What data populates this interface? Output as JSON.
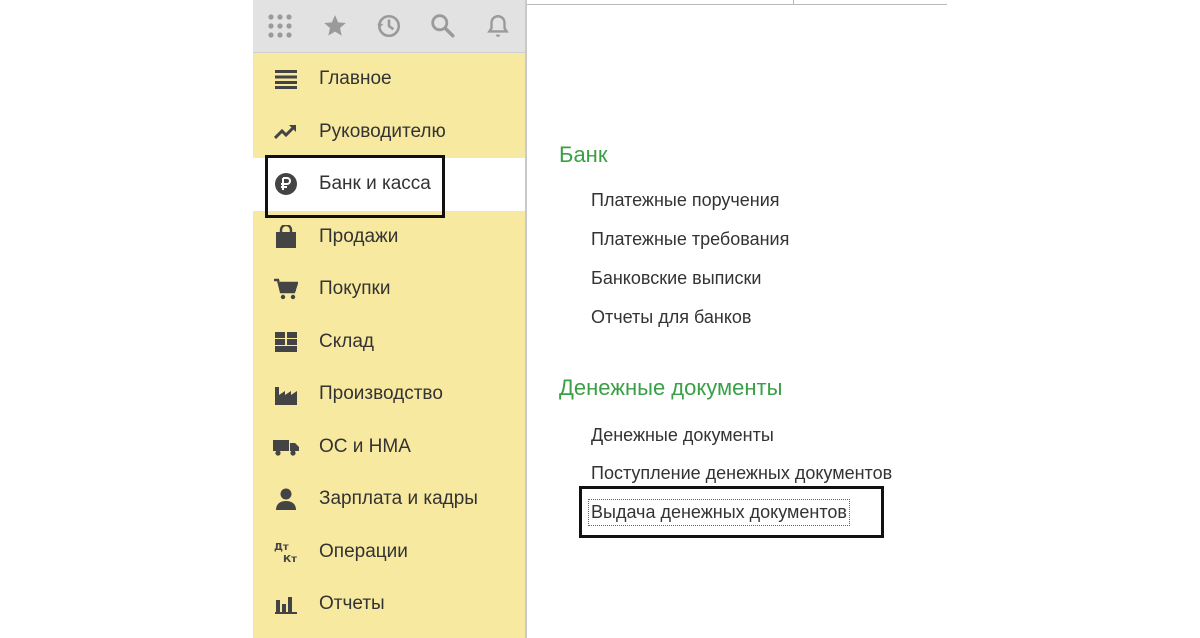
{
  "toolbar": {
    "icons": [
      "apps-grid-icon",
      "favorites-star-icon",
      "history-icon",
      "search-icon",
      "notifications-bell-icon"
    ]
  },
  "sidebar": {
    "items": [
      {
        "label": "Главное",
        "icon": "menu-lines-icon"
      },
      {
        "label": "Руководителю",
        "icon": "trend-up-icon"
      },
      {
        "label": "Банк и касса",
        "icon": "ruble-coin-icon",
        "active": true
      },
      {
        "label": "Продажи",
        "icon": "shopping-bag-icon"
      },
      {
        "label": "Покупки",
        "icon": "cart-icon"
      },
      {
        "label": "Склад",
        "icon": "warehouse-grid-icon"
      },
      {
        "label": "Производство",
        "icon": "factory-icon"
      },
      {
        "label": "ОС и НМА",
        "icon": "truck-icon"
      },
      {
        "label": "Зарплата и кадры",
        "icon": "person-icon"
      },
      {
        "label": "Операции",
        "icon": "debit-credit-icon"
      },
      {
        "label": "Отчеты",
        "icon": "bar-chart-icon"
      }
    ]
  },
  "content": {
    "sections": [
      {
        "title": "Банк",
        "links": [
          "Платежные поручения",
          "Платежные требования",
          "Банковские выписки",
          "Отчеты для банков"
        ]
      },
      {
        "title": "Денежные документы",
        "links": [
          "Денежные документы",
          "Поступление денежных документов",
          "Выдача денежных документов"
        ]
      }
    ]
  },
  "colors": {
    "sidebar_bg": "#f8e9a1",
    "section_title": "#3a9f45",
    "toolbar_bg": "#e2e2e2"
  }
}
